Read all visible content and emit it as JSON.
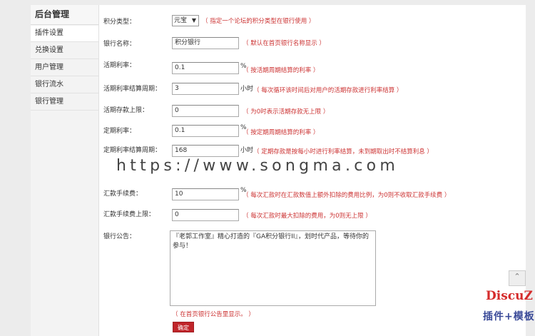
{
  "sidebar": {
    "title": "后台管理",
    "items": [
      {
        "label": "插件设置",
        "active": true
      },
      {
        "label": "兑换设置"
      },
      {
        "label": "用户管理"
      },
      {
        "label": "银行流水"
      },
      {
        "label": "银行管理"
      }
    ]
  },
  "form": {
    "credit_type": {
      "label": "积分类型：",
      "value": "元宝",
      "note": "（ 指定一个论坛的积分类型在银行使用 ）"
    },
    "bank_name": {
      "label": "银行名称：",
      "value": "积分银行",
      "note": "（ 默认在首页银行名称显示 ）"
    },
    "demand_rate": {
      "label": "活期利率：",
      "value": "0.1",
      "unit": "%",
      "note": "（ 按活期周期结算的利率 ）"
    },
    "demand_cycle": {
      "label": "活期利率结算周期：",
      "value": "3",
      "unit": "小时",
      "note": "（ 每次循环该时间后对用户的活期存款进行利率结算 ）"
    },
    "demand_limit": {
      "label": "活期存款上限：",
      "value": "0",
      "note": "（ 为0时表示活期存款无上限 ）"
    },
    "fixed_rate": {
      "label": "定期利率：",
      "value": "0.1",
      "unit": "%",
      "note": "（ 按定期周期结算的利率 ）"
    },
    "fixed_cycle": {
      "label": "定期利率结算周期：",
      "value": "168",
      "unit": "小时",
      "note": "（ 定期存款是按每小时进行利率结算，未到期取出时不结算利息 ）"
    },
    "transfer_fee": {
      "label": "汇款手续费：",
      "value": "10",
      "unit": "%",
      "note": "（ 每次汇款时在汇款数值上额外扣除的费用比例，为0则不收取汇款手续费 ）"
    },
    "transfer_fee_limit": {
      "label": "汇款手续费上限：",
      "value": "0",
      "note": "（ 每次汇款时最大扣除的费用，为0则无上限 ）"
    },
    "announcement": {
      "label": "银行公告：",
      "value": "『老郭工作室』精心打造的『GA积分银行II』，划时代产品，等待你的参与！",
      "note": "（ 在首页银行公告里显示。 ）"
    },
    "submit_label": "确定"
  },
  "watermark": "https://www.songma.com",
  "logo": {
    "line1": "DiscuZ",
    "line2": "插件+模板"
  },
  "colors": {
    "accent": "#c0252a",
    "note": "#cc3333"
  }
}
